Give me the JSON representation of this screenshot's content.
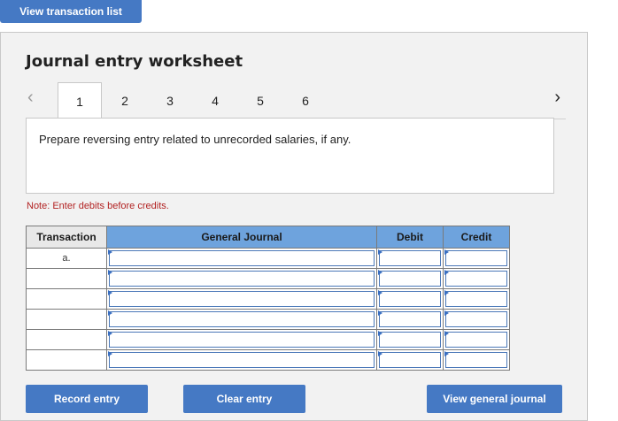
{
  "top": {
    "view_list_label": "View transaction list"
  },
  "worksheet": {
    "title": "Journal entry worksheet",
    "tabs": [
      "1",
      "2",
      "3",
      "4",
      "5",
      "6"
    ],
    "active_tab": "1",
    "prompt": "Prepare reversing entry related to unrecorded salaries, if any.",
    "note": "Note: Enter debits before credits."
  },
  "table": {
    "headers": {
      "transaction": "Transaction",
      "general_journal": "General Journal",
      "debit": "Debit",
      "credit": "Credit"
    },
    "rows": [
      {
        "transaction": "a.",
        "account": "",
        "debit": "",
        "credit": ""
      },
      {
        "transaction": "",
        "account": "",
        "debit": "",
        "credit": ""
      },
      {
        "transaction": "",
        "account": "",
        "debit": "",
        "credit": ""
      },
      {
        "transaction": "",
        "account": "",
        "debit": "",
        "credit": ""
      },
      {
        "transaction": "",
        "account": "",
        "debit": "",
        "credit": ""
      },
      {
        "transaction": "",
        "account": "",
        "debit": "",
        "credit": ""
      }
    ]
  },
  "buttons": {
    "record": "Record entry",
    "clear": "Clear entry",
    "view_journal": "View general journal"
  },
  "colors": {
    "accent": "#4579c4",
    "header_blue": "#6ea3dd",
    "note_red": "#b22222"
  },
  "icons": {
    "prev": "chevron-left-icon",
    "next": "chevron-right-icon"
  }
}
